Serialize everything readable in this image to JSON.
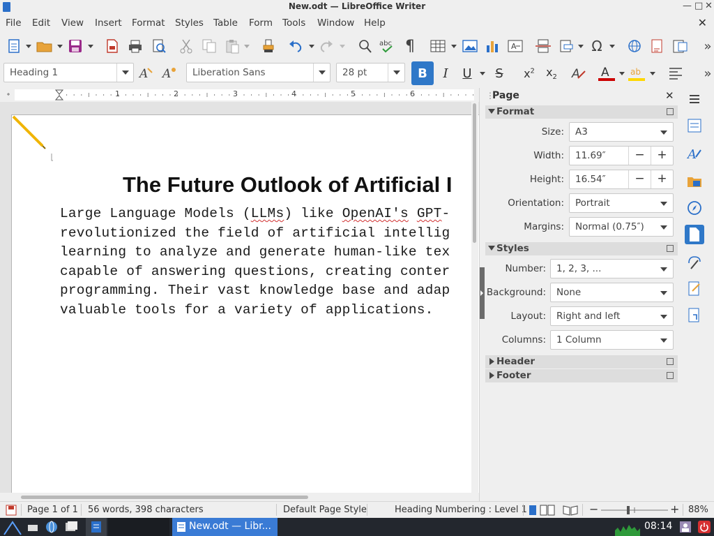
{
  "window": {
    "title": "New.odt — LibreOffice Writer"
  },
  "menu": [
    "File",
    "Edit",
    "View",
    "Insert",
    "Format",
    "Styles",
    "Table",
    "Form",
    "Tools",
    "Window",
    "Help"
  ],
  "format_toolbar": {
    "paragraph_style": "Heading 1",
    "font_name": "Liberation Sans",
    "font_size": "28 pt",
    "bold_label": "B",
    "italic_label": "I",
    "underline_label": "U",
    "strike_label": "S"
  },
  "ruler": {
    "numbers": [
      "1",
      "2",
      "3",
      "4",
      "5",
      "6"
    ]
  },
  "document": {
    "heading": "The Future Outlook of Artificial I",
    "lines": [
      "Large Language Models (LLMs) like OpenAI's GPT-",
      "revolutionized the field of artificial intellig",
      "learning to analyze and generate human-like tex",
      "capable of answering questions, creating conter",
      "programming. Their vast knowledge base and adap",
      "valuable tools for a variety of applications."
    ]
  },
  "sidebar": {
    "title": "Page",
    "format_section": "Format",
    "size_label": "Size:",
    "size_value": "A3",
    "width_label": "Width:",
    "width_value": "11.69″",
    "height_label": "Height:",
    "height_value": "16.54″",
    "orientation_label": "Orientation:",
    "orientation_value": "Portrait",
    "margins_label": "Margins:",
    "margins_value": "Normal (0.75″)",
    "styles_section": "Styles",
    "number_label": "Number:",
    "number_value": "1, 2, 3, ...",
    "background_label": "Background:",
    "background_value": "None",
    "layout_label": "Layout:",
    "layout_value": "Right and left",
    "columns_label": "Columns:",
    "columns_value": "1 Column",
    "header_section": "Header",
    "footer_section": "Footer"
  },
  "status": {
    "page": "Page 1 of 1",
    "words": "56 words, 398 characters",
    "page_style": "Default Page Style",
    "outline": "Heading Numbering : Level 1",
    "zoom": "88%"
  },
  "taskbar": {
    "app_label": "New.odt — Libr...",
    "clock": "08:14"
  },
  "colors": {
    "accent": "#2f78c8",
    "font_color": "#cc0000",
    "highlight": "#ffd700"
  }
}
